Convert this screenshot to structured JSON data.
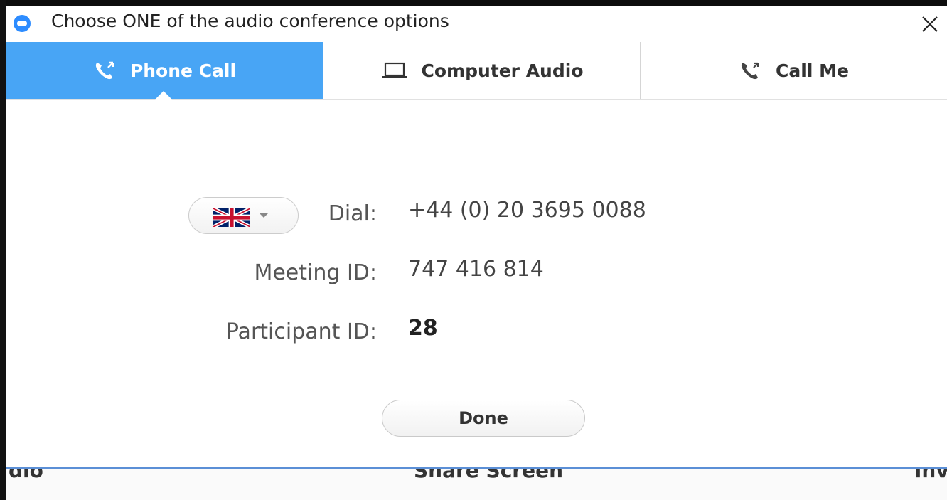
{
  "dialog": {
    "title": "Choose ONE of the audio conference options"
  },
  "tabs": [
    {
      "label": "Phone Call",
      "icon": "phone-icon",
      "active": true
    },
    {
      "label": "Computer Audio",
      "icon": "laptop-icon",
      "active": false
    },
    {
      "label": "Call Me",
      "icon": "phone-icon",
      "active": false
    }
  ],
  "dial_info": {
    "country_flag": "uk-flag-icon",
    "dial_label": "Dial:",
    "dial_number": "+44 (0) 20 3695 0088",
    "meeting_id_label": "Meeting ID:",
    "meeting_id": "747 416 814",
    "participant_id_label": "Participant ID:",
    "participant_id": "28"
  },
  "done_label": "Done",
  "bottom_toolbar": {
    "left_label": "dio",
    "center_label": "Share Screen",
    "right_label": "Inv"
  },
  "colors": {
    "active_tab": "#48a5f5",
    "toolbar_accent": "#5b8fd6"
  }
}
